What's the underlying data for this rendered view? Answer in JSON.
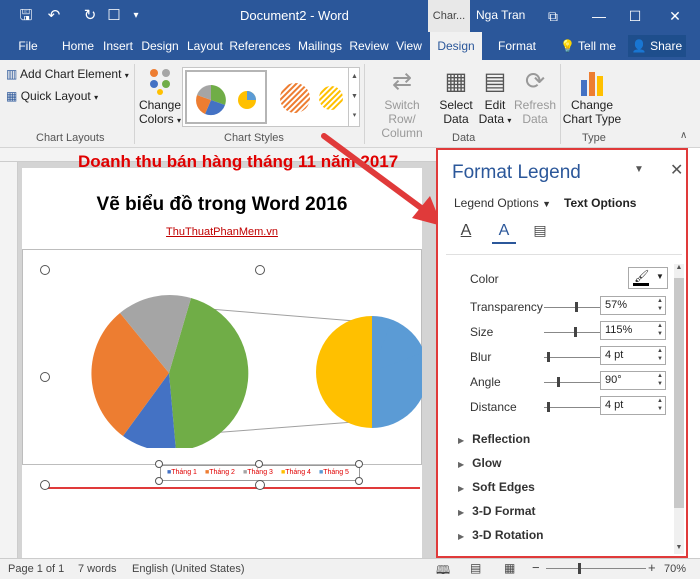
{
  "titlebar": {
    "title": "Document2 - Word",
    "chart_tools": "Char...",
    "user": "Nga Tran"
  },
  "tabs": [
    {
      "label": "File"
    },
    {
      "label": "Home"
    },
    {
      "label": "Insert"
    },
    {
      "label": "Design"
    },
    {
      "label": "Layout"
    },
    {
      "label": "References"
    },
    {
      "label": "Mailings"
    },
    {
      "label": "Review"
    },
    {
      "label": "View"
    },
    {
      "label": "Design"
    },
    {
      "label": "Format"
    }
  ],
  "tell_me": "Tell me",
  "share": "Share",
  "ribbon": {
    "add_chart_element": "Add Chart Element",
    "quick_layout": "Quick Layout",
    "change_colors_1": "Change",
    "change_colors_2": "Colors",
    "chart_layouts_label": "Chart Layouts",
    "chart_styles_label": "Chart Styles",
    "switch_row_1": "Switch Row/",
    "switch_row_2": "Column",
    "select_data_1": "Select",
    "select_data_2": "Data",
    "edit_data_1": "Edit",
    "edit_data_2": "Data",
    "refresh_data_1": "Refresh",
    "refresh_data_2": "Data",
    "data_label": "Data",
    "change_type_1": "Change",
    "change_type_2": "Chart Type",
    "type_label": "Type"
  },
  "document": {
    "heading": "Vẽ biểu đồ trong Word 2016",
    "link": "ThuThuatPhanMem.vn",
    "chart_title": "Doanh thu bán hàng tháng 11 năm 2017",
    "legend": [
      "Tháng 1",
      "Tháng 2",
      "Tháng 3",
      "Tháng 4",
      "Tháng 5"
    ]
  },
  "colors": {
    "ribbon_blue": "#2b579a",
    "pie_orange": "#ed7d31",
    "pie_gray": "#a5a5a5",
    "pie_green": "#70ad47",
    "pie_blue": "#4472c4",
    "pie_yellow": "#ffc000",
    "pie_lightblue": "#5b9bd5",
    "pane_border": "#e03a3a"
  },
  "pane": {
    "title": "Format Legend",
    "legend_options": "Legend Options",
    "text_options": "Text Options",
    "color_label": "Color",
    "rows": [
      {
        "label": "Transparency",
        "value": "57%"
      },
      {
        "label": "Size",
        "value": "115%"
      },
      {
        "label": "Blur",
        "value": "4 pt"
      },
      {
        "label": "Angle",
        "value": "90°"
      },
      {
        "label": "Distance",
        "value": "4 pt"
      }
    ],
    "sections": [
      "Reflection",
      "Glow",
      "Soft Edges",
      "3-D Format",
      "3-D Rotation"
    ]
  },
  "statusbar": {
    "page": "Page 1 of 1",
    "words": "7 words",
    "language": "English (United States)",
    "zoom": "70%"
  }
}
